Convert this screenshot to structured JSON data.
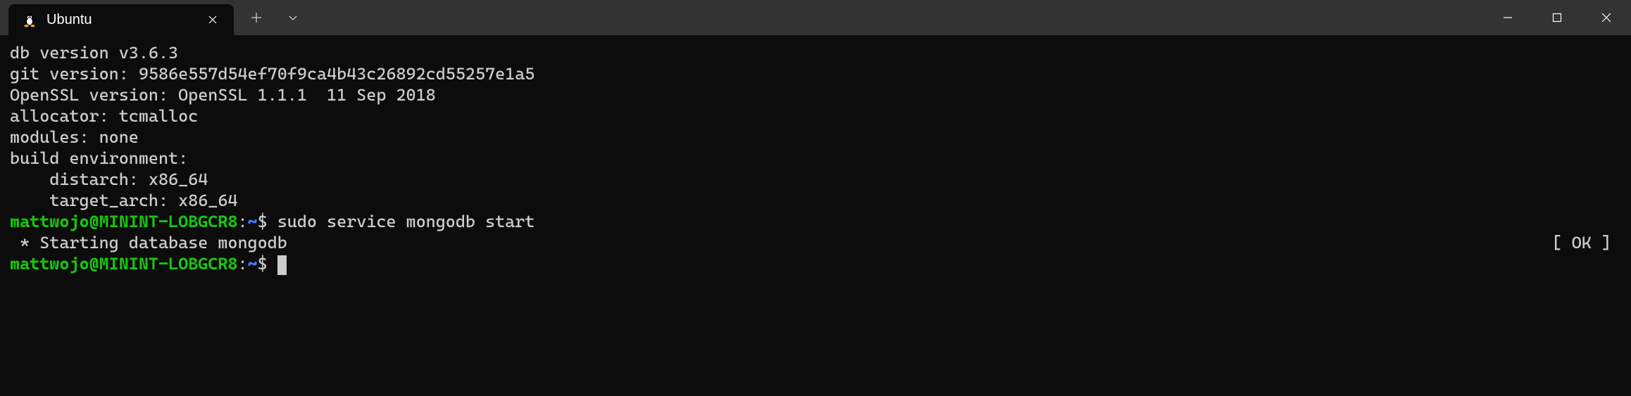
{
  "titlebar": {
    "tab": {
      "title": "Ubuntu",
      "icon": "tux-icon"
    },
    "new_tab_label": "+",
    "dropdown_label": "⌄"
  },
  "terminal": {
    "lines": [
      "db version v3.6.3",
      "git version: 9586e557d54ef70f9ca4b43c26892cd55257e1a5",
      "OpenSSL version: OpenSSL 1.1.1  11 Sep 2018",
      "allocator: tcmalloc",
      "modules: none",
      "build environment:",
      "    distarch: x86_64",
      "    target_arch: x86_64"
    ],
    "prompt1": {
      "userhost": "mattwojo@MININT-LOBGCR8",
      "sep": ":",
      "path": "~",
      "dollar": "$ ",
      "command": "sudo service mongodb start"
    },
    "status": {
      "left": " * Starting database mongodb",
      "right": "[ OK ] "
    },
    "prompt2": {
      "userhost": "mattwojo@MININT-LOBGCR8",
      "sep": ":",
      "path": "~",
      "dollar": "$ "
    }
  },
  "colors": {
    "prompt_green": "#16c60c",
    "prompt_blue": "#3b78ff",
    "bg_terminal": "#0c0c0c",
    "bg_titlebar": "#333333",
    "fg": "#cccccc"
  }
}
